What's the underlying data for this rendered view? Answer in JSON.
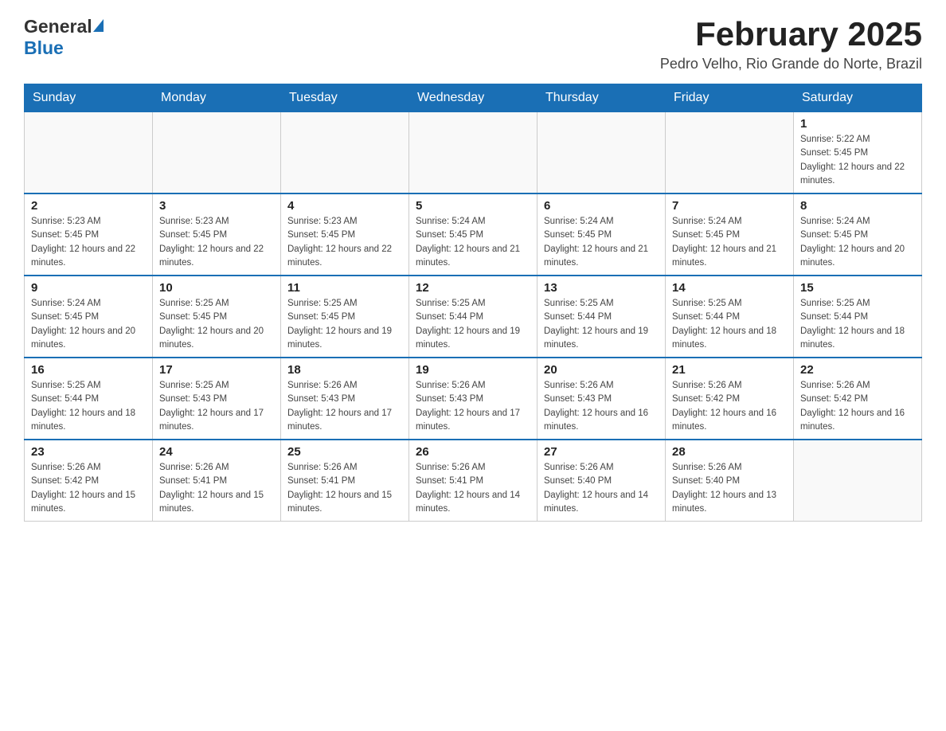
{
  "header": {
    "logo_general": "General",
    "logo_blue": "Blue",
    "main_title": "February 2025",
    "subtitle": "Pedro Velho, Rio Grande do Norte, Brazil"
  },
  "weekdays": [
    "Sunday",
    "Monday",
    "Tuesday",
    "Wednesday",
    "Thursday",
    "Friday",
    "Saturday"
  ],
  "weeks": [
    [
      {
        "day": "",
        "info": ""
      },
      {
        "day": "",
        "info": ""
      },
      {
        "day": "",
        "info": ""
      },
      {
        "day": "",
        "info": ""
      },
      {
        "day": "",
        "info": ""
      },
      {
        "day": "",
        "info": ""
      },
      {
        "day": "1",
        "info": "Sunrise: 5:22 AM\nSunset: 5:45 PM\nDaylight: 12 hours and 22 minutes."
      }
    ],
    [
      {
        "day": "2",
        "info": "Sunrise: 5:23 AM\nSunset: 5:45 PM\nDaylight: 12 hours and 22 minutes."
      },
      {
        "day": "3",
        "info": "Sunrise: 5:23 AM\nSunset: 5:45 PM\nDaylight: 12 hours and 22 minutes."
      },
      {
        "day": "4",
        "info": "Sunrise: 5:23 AM\nSunset: 5:45 PM\nDaylight: 12 hours and 22 minutes."
      },
      {
        "day": "5",
        "info": "Sunrise: 5:24 AM\nSunset: 5:45 PM\nDaylight: 12 hours and 21 minutes."
      },
      {
        "day": "6",
        "info": "Sunrise: 5:24 AM\nSunset: 5:45 PM\nDaylight: 12 hours and 21 minutes."
      },
      {
        "day": "7",
        "info": "Sunrise: 5:24 AM\nSunset: 5:45 PM\nDaylight: 12 hours and 21 minutes."
      },
      {
        "day": "8",
        "info": "Sunrise: 5:24 AM\nSunset: 5:45 PM\nDaylight: 12 hours and 20 minutes."
      }
    ],
    [
      {
        "day": "9",
        "info": "Sunrise: 5:24 AM\nSunset: 5:45 PM\nDaylight: 12 hours and 20 minutes."
      },
      {
        "day": "10",
        "info": "Sunrise: 5:25 AM\nSunset: 5:45 PM\nDaylight: 12 hours and 20 minutes."
      },
      {
        "day": "11",
        "info": "Sunrise: 5:25 AM\nSunset: 5:45 PM\nDaylight: 12 hours and 19 minutes."
      },
      {
        "day": "12",
        "info": "Sunrise: 5:25 AM\nSunset: 5:44 PM\nDaylight: 12 hours and 19 minutes."
      },
      {
        "day": "13",
        "info": "Sunrise: 5:25 AM\nSunset: 5:44 PM\nDaylight: 12 hours and 19 minutes."
      },
      {
        "day": "14",
        "info": "Sunrise: 5:25 AM\nSunset: 5:44 PM\nDaylight: 12 hours and 18 minutes."
      },
      {
        "day": "15",
        "info": "Sunrise: 5:25 AM\nSunset: 5:44 PM\nDaylight: 12 hours and 18 minutes."
      }
    ],
    [
      {
        "day": "16",
        "info": "Sunrise: 5:25 AM\nSunset: 5:44 PM\nDaylight: 12 hours and 18 minutes."
      },
      {
        "day": "17",
        "info": "Sunrise: 5:25 AM\nSunset: 5:43 PM\nDaylight: 12 hours and 17 minutes."
      },
      {
        "day": "18",
        "info": "Sunrise: 5:26 AM\nSunset: 5:43 PM\nDaylight: 12 hours and 17 minutes."
      },
      {
        "day": "19",
        "info": "Sunrise: 5:26 AM\nSunset: 5:43 PM\nDaylight: 12 hours and 17 minutes."
      },
      {
        "day": "20",
        "info": "Sunrise: 5:26 AM\nSunset: 5:43 PM\nDaylight: 12 hours and 16 minutes."
      },
      {
        "day": "21",
        "info": "Sunrise: 5:26 AM\nSunset: 5:42 PM\nDaylight: 12 hours and 16 minutes."
      },
      {
        "day": "22",
        "info": "Sunrise: 5:26 AM\nSunset: 5:42 PM\nDaylight: 12 hours and 16 minutes."
      }
    ],
    [
      {
        "day": "23",
        "info": "Sunrise: 5:26 AM\nSunset: 5:42 PM\nDaylight: 12 hours and 15 minutes."
      },
      {
        "day": "24",
        "info": "Sunrise: 5:26 AM\nSunset: 5:41 PM\nDaylight: 12 hours and 15 minutes."
      },
      {
        "day": "25",
        "info": "Sunrise: 5:26 AM\nSunset: 5:41 PM\nDaylight: 12 hours and 15 minutes."
      },
      {
        "day": "26",
        "info": "Sunrise: 5:26 AM\nSunset: 5:41 PM\nDaylight: 12 hours and 14 minutes."
      },
      {
        "day": "27",
        "info": "Sunrise: 5:26 AM\nSunset: 5:40 PM\nDaylight: 12 hours and 14 minutes."
      },
      {
        "day": "28",
        "info": "Sunrise: 5:26 AM\nSunset: 5:40 PM\nDaylight: 12 hours and 13 minutes."
      },
      {
        "day": "",
        "info": ""
      }
    ]
  ]
}
